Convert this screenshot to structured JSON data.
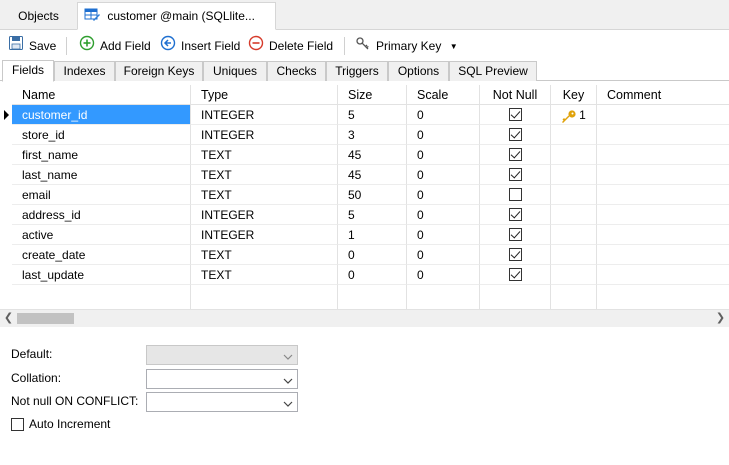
{
  "doc_tabs": {
    "objects": "Objects",
    "active": "customer @main (SQLlite..."
  },
  "toolbar": {
    "save": "Save",
    "add_field": "Add Field",
    "insert_field": "Insert Field",
    "delete_field": "Delete Field",
    "primary_key": "Primary Key"
  },
  "section_tabs": [
    "Fields",
    "Indexes",
    "Foreign Keys",
    "Uniques",
    "Checks",
    "Triggers",
    "Options",
    "SQL Preview"
  ],
  "grid": {
    "columns": [
      "Name",
      "Type",
      "Size",
      "Scale",
      "Not Null",
      "Key",
      "Comment"
    ],
    "rows": [
      {
        "name": "customer_id",
        "type": "INTEGER",
        "size": "5",
        "scale": "0",
        "not_null": true,
        "key": "1"
      },
      {
        "name": "store_id",
        "type": "INTEGER",
        "size": "3",
        "scale": "0",
        "not_null": true,
        "key": ""
      },
      {
        "name": "first_name",
        "type": "TEXT",
        "size": "45",
        "scale": "0",
        "not_null": true,
        "key": ""
      },
      {
        "name": "last_name",
        "type": "TEXT",
        "size": "45",
        "scale": "0",
        "not_null": true,
        "key": ""
      },
      {
        "name": "email",
        "type": "TEXT",
        "size": "50",
        "scale": "0",
        "not_null": false,
        "key": ""
      },
      {
        "name": "address_id",
        "type": "INTEGER",
        "size": "5",
        "scale": "0",
        "not_null": true,
        "key": ""
      },
      {
        "name": "active",
        "type": "INTEGER",
        "size": "1",
        "scale": "0",
        "not_null": true,
        "key": ""
      },
      {
        "name": "create_date",
        "type": "TEXT",
        "size": "0",
        "scale": "0",
        "not_null": true,
        "key": ""
      },
      {
        "name": "last_update",
        "type": "TEXT",
        "size": "0",
        "scale": "0",
        "not_null": true,
        "key": ""
      }
    ]
  },
  "properties": {
    "default_label": "Default:",
    "collation_label": "Collation:",
    "not_null_conflict_label": "Not null ON CONFLICT:",
    "auto_increment_label": "Auto Increment"
  },
  "colors": {
    "selection": "#3399ff",
    "add_icon": "#2e9e2e",
    "insert_icon": "#1e6fd0",
    "delete_icon": "#d63a2a",
    "key_icon": "#e0a20a"
  },
  "icons": {
    "save": "floppy-disk-icon",
    "add": "plus-circle-icon",
    "insert": "arrow-left-circle-icon",
    "delete": "minus-circle-icon",
    "primary_key": "key-icon"
  }
}
